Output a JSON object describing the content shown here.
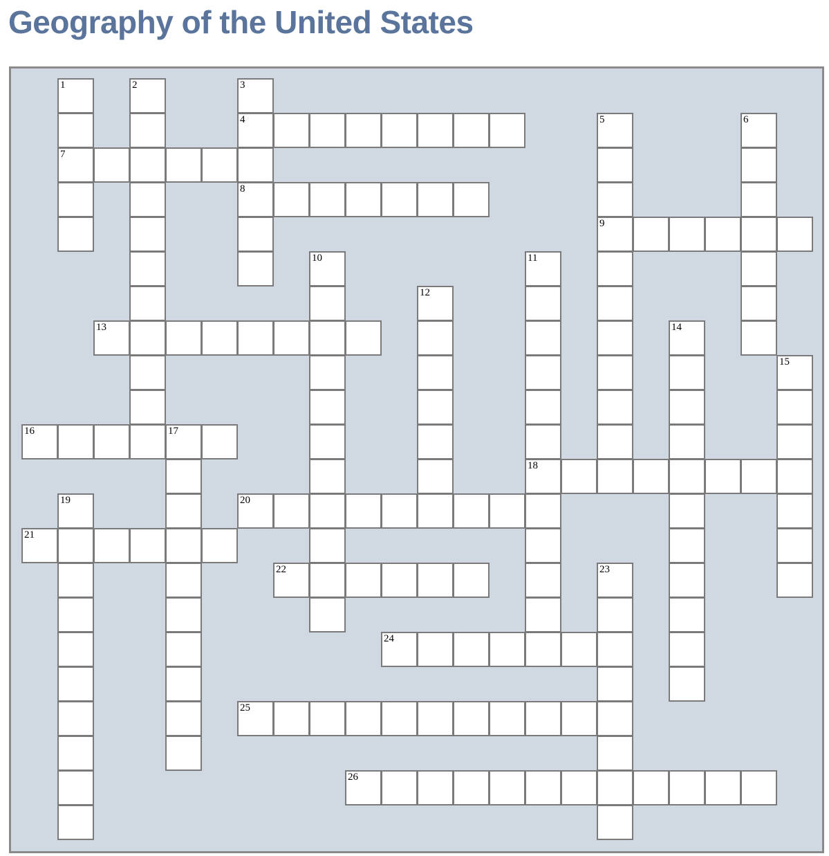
{
  "title": "Geography of the United States",
  "colors": {
    "title": "#5a749c",
    "board_background": "#d0d9e1",
    "cell_fill": "#ffffff",
    "cell_border": "#7a7a7a"
  },
  "grid": {
    "columns": 22,
    "rows": 22
  },
  "words": [
    {
      "n": "1",
      "dir": "down",
      "row": 0,
      "col": 1,
      "len": 5
    },
    {
      "n": "2",
      "dir": "down",
      "row": 0,
      "col": 3,
      "len": 10
    },
    {
      "n": "3",
      "dir": "down",
      "row": 0,
      "col": 6,
      "len": 6
    },
    {
      "n": "4",
      "dir": "across",
      "row": 1,
      "col": 6,
      "len": 8
    },
    {
      "n": "5",
      "dir": "down",
      "row": 1,
      "col": 16,
      "len": 11
    },
    {
      "n": "6",
      "dir": "down",
      "row": 1,
      "col": 20,
      "len": 7
    },
    {
      "n": "7",
      "dir": "across",
      "row": 2,
      "col": 1,
      "len": 6
    },
    {
      "n": "8",
      "dir": "across",
      "row": 3,
      "col": 6,
      "len": 7
    },
    {
      "n": "9",
      "dir": "across",
      "row": 4,
      "col": 16,
      "len": 6
    },
    {
      "n": "10",
      "dir": "down",
      "row": 5,
      "col": 8,
      "len": 11
    },
    {
      "n": "11",
      "dir": "down",
      "row": 5,
      "col": 14,
      "len": 11
    },
    {
      "n": "12",
      "dir": "down",
      "row": 6,
      "col": 11,
      "len": 7
    },
    {
      "n": "13",
      "dir": "across",
      "row": 7,
      "col": 2,
      "len": 8
    },
    {
      "n": "14",
      "dir": "down",
      "row": 7,
      "col": 18,
      "len": 11
    },
    {
      "n": "15",
      "dir": "down",
      "row": 8,
      "col": 21,
      "len": 7
    },
    {
      "n": "16",
      "dir": "across",
      "row": 10,
      "col": 0,
      "len": 6
    },
    {
      "n": "17",
      "dir": "down",
      "row": 10,
      "col": 4,
      "len": 10
    },
    {
      "n": "18",
      "dir": "across",
      "row": 11,
      "col": 14,
      "len": 8
    },
    {
      "n": "19",
      "dir": "down",
      "row": 12,
      "col": 1,
      "len": 10
    },
    {
      "n": "20",
      "dir": "across",
      "row": 12,
      "col": 6,
      "len": 9
    },
    {
      "n": "21",
      "dir": "across",
      "row": 13,
      "col": 0,
      "len": 6
    },
    {
      "n": "22",
      "dir": "across",
      "row": 14,
      "col": 7,
      "len": 6
    },
    {
      "n": "23",
      "dir": "down",
      "row": 14,
      "col": 16,
      "len": 8
    },
    {
      "n": "24",
      "dir": "across",
      "row": 16,
      "col": 10,
      "len": 7
    },
    {
      "n": "25",
      "dir": "across",
      "row": 18,
      "col": 6,
      "len": 11
    },
    {
      "n": "26",
      "dir": "across",
      "row": 20,
      "col": 9,
      "len": 12
    }
  ]
}
